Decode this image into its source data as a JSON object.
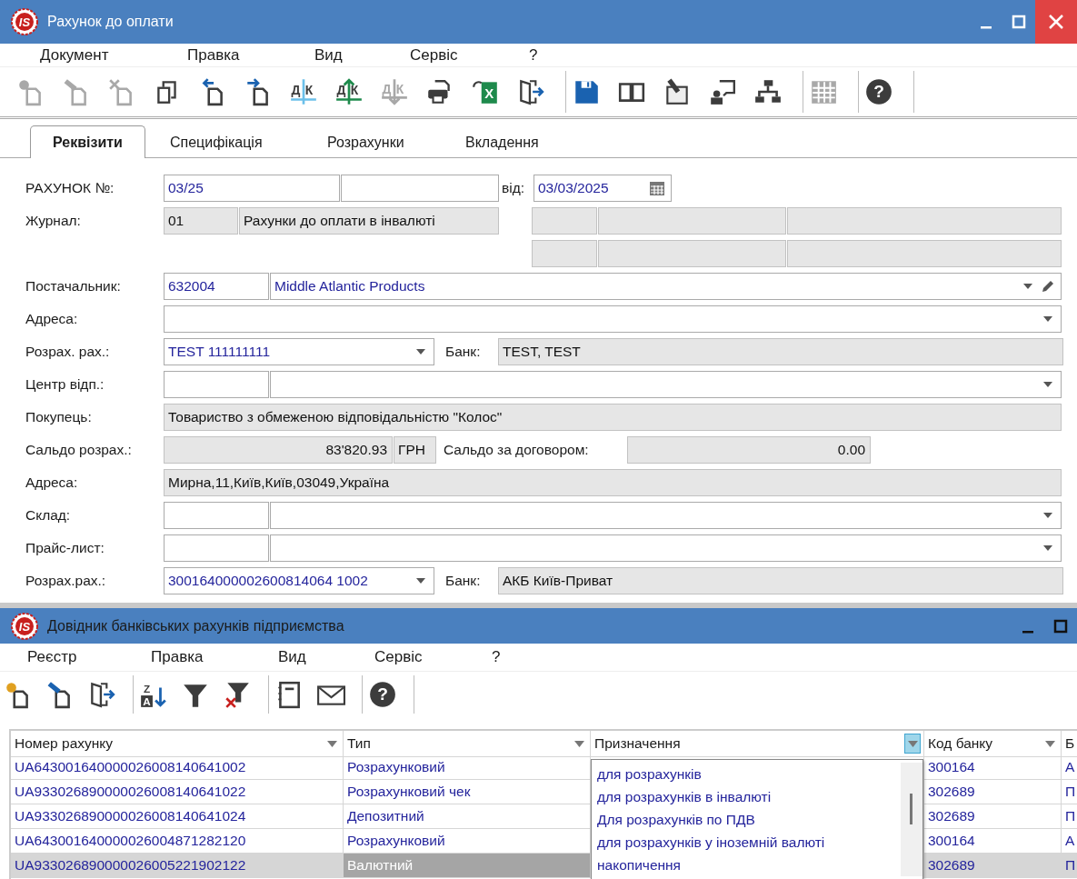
{
  "document_window": {
    "logo": "IS",
    "title": "Рахунок до оплати",
    "active": true,
    "menu": [
      "Документ",
      "Правка",
      "Вид",
      "Сервіс",
      "?"
    ],
    "toolbar": [
      {
        "buttons": [
          {
            "kind": "new",
            "disabled": true
          },
          {
            "kind": "edit",
            "disabled": true
          },
          {
            "kind": "delete",
            "disabled": true
          },
          {
            "kind": "copy",
            "disabled": false
          },
          {
            "kind": "import",
            "disabled": false
          },
          {
            "kind": "export",
            "disabled": false
          },
          {
            "kind": "dk",
            "label": "ДК",
            "disabled": false
          },
          {
            "kind": "dk-up",
            "label": "ДК",
            "disabled": false
          },
          {
            "kind": "dk-down",
            "label": "ДК",
            "disabled": true
          },
          {
            "kind": "print",
            "disabled": false
          },
          {
            "kind": "excel",
            "label": "X",
            "disabled": false
          },
          {
            "kind": "exit",
            "disabled": false
          }
        ]
      },
      {
        "buttons": [
          {
            "kind": "save",
            "disabled": false
          },
          {
            "kind": "book",
            "disabled": false
          },
          {
            "kind": "edit-doc",
            "disabled": false
          },
          {
            "kind": "user-message",
            "disabled": false
          },
          {
            "kind": "tree",
            "disabled": false
          }
        ]
      },
      {
        "buttons": [
          {
            "kind": "grid",
            "disabled": true
          }
        ]
      },
      {
        "buttons": [
          {
            "kind": "help",
            "label": "?",
            "disabled": false
          }
        ]
      }
    ],
    "tabs": [
      {
        "label": "Реквізити",
        "selected": true
      },
      {
        "label": "Специфікація",
        "selected": false
      },
      {
        "label": "Розрахунки",
        "selected": false
      },
      {
        "label": "Вкладення",
        "selected": false
      }
    ],
    "form": [
      {
        "label": "РАХУНОК №:",
        "items": [
          {
            "kind": "field",
            "value": "03/25"
          },
          {
            "kind": "field"
          },
          {
            "kind": "label",
            "text": "від:"
          },
          {
            "kind": "date",
            "value": "03/03/2025"
          }
        ]
      },
      {
        "label": "Журнал:",
        "items": [
          {
            "kind": "readonly",
            "value": "01"
          },
          {
            "kind": "readonly",
            "value": "Рахунки до оплати в інвалюті"
          },
          {
            "kind": "readonly"
          },
          {
            "kind": "readonly"
          },
          {
            "kind": "readonly"
          }
        ]
      },
      {
        "items": [
          {
            "kind": "readonly"
          },
          {
            "kind": "readonly"
          },
          {
            "kind": "readonly"
          }
        ]
      },
      {
        "label": "Постачальник:",
        "items": [
          {
            "kind": "field",
            "value": "632004"
          },
          {
            "kind": "combo-edit",
            "value": "Middle Atlantic Products"
          }
        ]
      },
      {
        "label": "Адреса:",
        "items": [
          {
            "kind": "combo"
          }
        ]
      },
      {
        "label": "Розрах. рах.:",
        "items": [
          {
            "kind": "combo",
            "value": "TEST 111111111"
          },
          {
            "kind": "label",
            "text": "Банк:"
          },
          {
            "kind": "readonly",
            "value": "TEST, TEST"
          }
        ]
      },
      {
        "label": "Центр відп.:",
        "items": [
          {
            "kind": "field"
          },
          {
            "kind": "combo"
          }
        ]
      },
      {
        "label": "Покупець:",
        "items": [
          {
            "kind": "readonly",
            "value": "Товариство з обмеженою відповідальністю \"Колос\""
          }
        ]
      },
      {
        "label": "Сальдо розрах.:",
        "items": [
          {
            "kind": "amount",
            "value": "83'820.93"
          },
          {
            "kind": "readonly",
            "value": "ГРН"
          },
          {
            "kind": "label",
            "text": "Сальдо за договором:"
          },
          {
            "kind": "amount",
            "value": "0.00"
          }
        ]
      },
      {
        "label": "Адреса:",
        "items": [
          {
            "kind": "readonly",
            "value": "Мирна,11,Київ,Київ,03049,Україна"
          }
        ]
      },
      {
        "label": "Склад:",
        "items": [
          {
            "kind": "field"
          },
          {
            "kind": "combo"
          }
        ]
      },
      {
        "label": "Прайс-лист:",
        "items": [
          {
            "kind": "field"
          },
          {
            "kind": "combo"
          }
        ]
      },
      {
        "label": "Розрах.рах.:",
        "items": [
          {
            "kind": "combo",
            "value": "300164000002600814064 1002"
          },
          {
            "kind": "label",
            "text": "Банк:"
          },
          {
            "kind": "readonly",
            "value": "АКБ Київ-Приват"
          }
        ]
      }
    ]
  },
  "accounts_window": {
    "logo": "IS",
    "title": "Довідник банківських рахунків підприємства",
    "active": false,
    "menu": [
      "Реєстр",
      "Правка",
      "Вид",
      "Сервіс",
      "?"
    ],
    "toolbar": [
      {
        "buttons": [
          {
            "kind": "new",
            "disabled": false
          },
          {
            "kind": "edit",
            "disabled": false
          },
          {
            "kind": "exit",
            "disabled": false
          }
        ]
      },
      {
        "buttons": [
          {
            "kind": "sort",
            "label": "ZA",
            "disabled": false
          },
          {
            "kind": "filter",
            "disabled": false
          },
          {
            "kind": "filter-clear",
            "disabled": false
          }
        ]
      },
      {
        "buttons": [
          {
            "kind": "notebook",
            "disabled": false
          },
          {
            "kind": "mail",
            "disabled": false
          }
        ]
      },
      {
        "buttons": [
          {
            "kind": "help",
            "label": "?",
            "disabled": false
          }
        ]
      }
    ],
    "table": {
      "columns": [
        {
          "title": "Номер рахунку",
          "filter_open": false
        },
        {
          "title": "Тип",
          "filter_open": false
        },
        {
          "title": "Призначення",
          "filter_open": true
        },
        {
          "title": "Код банку",
          "filter_open": false
        },
        {
          "title": "Б"
        }
      ],
      "rows": [
        {
          "selected": false,
          "cells": [
            {
              "text": "UA643001640000026008140641002",
              "focused": false
            },
            {
              "text": "Розрахунковий",
              "focused": false
            },
            {
              "text": ""
            },
            {
              "text": "300164",
              "focused": false
            },
            {
              "text": "А",
              "focused": false
            }
          ]
        },
        {
          "selected": false,
          "cells": [
            {
              "text": "UA933026890000026008140641022",
              "focused": false
            },
            {
              "text": "Розрахунковий чек",
              "focused": false
            },
            {
              "text": ""
            },
            {
              "text": "302689",
              "focused": false
            },
            {
              "text": "П",
              "focused": false
            }
          ]
        },
        {
          "selected": false,
          "cells": [
            {
              "text": "UA933026890000026008140641024",
              "focused": false
            },
            {
              "text": "Депозитний",
              "focused": false
            },
            {
              "text": ""
            },
            {
              "text": "302689",
              "focused": false
            },
            {
              "text": "П",
              "focused": false
            }
          ]
        },
        {
          "selected": false,
          "cells": [
            {
              "text": "UA643001640000026004871282120",
              "focused": false
            },
            {
              "text": "Розрахунковий",
              "focused": false
            },
            {
              "text": ""
            },
            {
              "text": "300164",
              "focused": false
            },
            {
              "text": "А",
              "focused": false
            }
          ]
        },
        {
          "selected": true,
          "cells": [
            {
              "text": "UA933026890000026005221902122",
              "focused": false
            },
            {
              "text": "Валютний",
              "focused": true
            },
            {
              "text": ""
            },
            {
              "text": "302689",
              "focused": false
            },
            {
              "text": "П",
              "focused": false
            }
          ]
        }
      ],
      "filter_dropdown": [
        "для розрахунків",
        "для розрахунків в інвалюті",
        "Для розрахунків по ПДВ",
        "для розрахунків у іноземній валюті",
        "накопичення"
      ]
    }
  }
}
